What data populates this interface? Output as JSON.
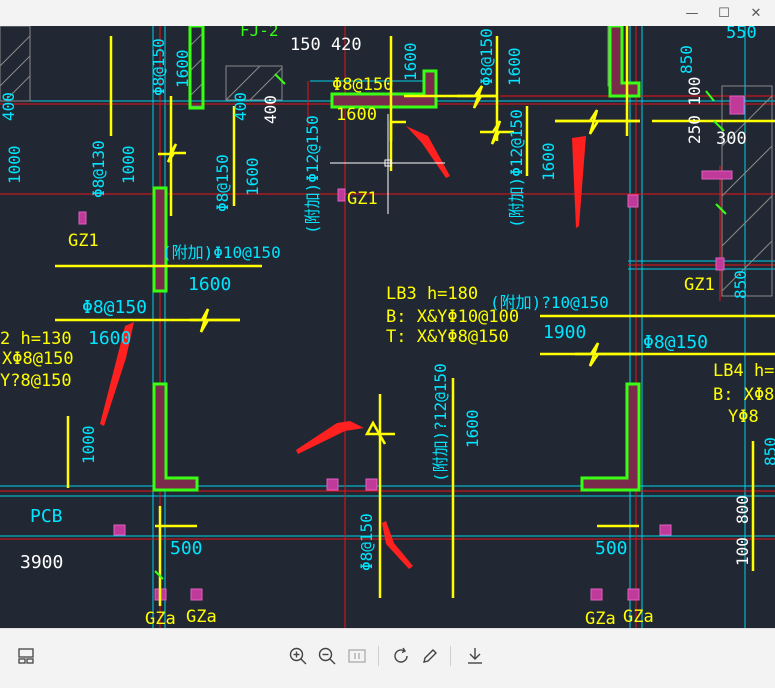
{
  "window": {
    "controls": {
      "minimize": "—",
      "maximize": "☐",
      "close": "✕"
    }
  },
  "drawing": {
    "labels": {
      "fj2": "FJ-2",
      "d150_420": "150 420",
      "r150_a": "Φ8@150",
      "r150_b": "Φ8@150",
      "r150_c": "Φ8@150",
      "r150_top3": "Φ8@150",
      "v1600_a": "1600",
      "v1600_b": "1600",
      "v1600_c": "1600",
      "v400_a": "400",
      "v400_b": "400",
      "v400_c": "400",
      "n1600_top": "1600",
      "v1000_a": "1000",
      "r130": "Φ8@130",
      "v1000_b": "1000",
      "r150_d": "Φ8@150",
      "v1600_d": "1600",
      "add12_a": "(附加)Φ12@150",
      "gz1_mid": "GZ1",
      "add12_b": "(附加)Φ12@150",
      "v1600_e": "1600",
      "n850": "850",
      "n250100": "250 100",
      "n300": "300",
      "n550": "550",
      "gz1_left": "GZ1",
      "add10": "(附加)Φ10@150",
      "n1600_l": "1600",
      "r150_e": "Φ8@150",
      "n1600_l2": "1600",
      "lb2": "2 h=130",
      "lb2_x": "XΦ8@150",
      "lb2_y": "Y?8@150",
      "v1000_c": "1000",
      "lb3": "LB3 h=180",
      "lb3_b": "B: X&YΦ10@100",
      "lb3_t": "T: X&YΦ8@150",
      "add10_q": "(附加)?10@150",
      "n1900": "1900",
      "r150_f": "Φ8@150",
      "gz1_right": "GZ1",
      "v850_r": "850",
      "lb4": "LB4 h=1",
      "lb4_b": "B: XΦ8",
      "lb4_y": "YΦ8",
      "add12_q": "(附加)?12@150",
      "v1600_f": "1600",
      "v850_r2": "850",
      "pcb": "PCB",
      "n3900": "3900",
      "n500_a": "500",
      "n500_b": "500",
      "r150_g": "Φ8@150",
      "v800": "800",
      "v100": "100",
      "gza_1": "GZa",
      "gza_2": "GZa",
      "gza_3": "GZa",
      "gza_4": "GZa"
    }
  },
  "toolbar": {
    "items": [
      "layout-icon",
      "zoom-in-icon",
      "zoom-out-icon",
      "fit-icon",
      "rotate-icon",
      "edit-icon",
      "download-icon"
    ]
  },
  "colors": {
    "canvas_bg": "#222833",
    "yellow": "#ffff00",
    "cyan": "#00e5ff",
    "red": "#e8121a",
    "green": "#39ff14",
    "magenta": "#c03a9a",
    "white": "#ffffff"
  }
}
